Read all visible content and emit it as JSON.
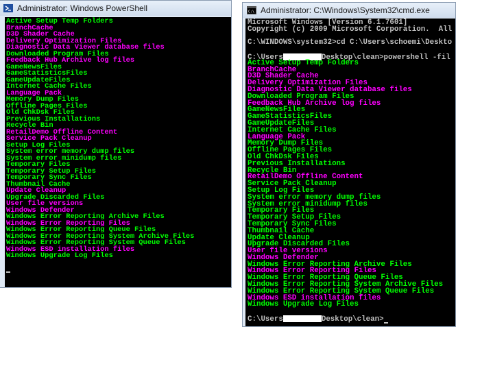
{
  "powershell_window": {
    "title": "Administrator: Windows PowerShell",
    "icon": "powershell-icon",
    "lines": [
      {
        "text": "Active Setup Temp Folders",
        "color": "green"
      },
      {
        "text": "BranchCache",
        "color": "magenta"
      },
      {
        "text": "D3D Shader Cache",
        "color": "magenta"
      },
      {
        "text": "Delivery Optimization Files",
        "color": "magenta"
      },
      {
        "text": "Diagnostic Data Viewer database files",
        "color": "magenta"
      },
      {
        "text": "Downloaded Program Files",
        "color": "green"
      },
      {
        "text": "Feedback Hub Archive log files",
        "color": "magenta"
      },
      {
        "text": "GameNewsFiles",
        "color": "green"
      },
      {
        "text": "GameStatisticsFiles",
        "color": "green"
      },
      {
        "text": "GameUpdateFiles",
        "color": "green"
      },
      {
        "text": "Internet Cache Files",
        "color": "green"
      },
      {
        "text": "Language Pack",
        "color": "magenta"
      },
      {
        "text": "Memory Dump Files",
        "color": "green"
      },
      {
        "text": "Offline Pages Files",
        "color": "green"
      },
      {
        "text": "Old ChkDsk Files",
        "color": "green"
      },
      {
        "text": "Previous Installations",
        "color": "green"
      },
      {
        "text": "Recycle Bin",
        "color": "green"
      },
      {
        "text": "RetailDemo Offline Content",
        "color": "magenta"
      },
      {
        "text": "Service Pack Cleanup",
        "color": "magenta"
      },
      {
        "text": "Setup Log Files",
        "color": "green"
      },
      {
        "text": "System error memory dump files",
        "color": "green"
      },
      {
        "text": "System error minidump files",
        "color": "green"
      },
      {
        "text": "Temporary Files",
        "color": "green"
      },
      {
        "text": "Temporary Setup Files",
        "color": "green"
      },
      {
        "text": "Temporary Sync Files",
        "color": "green"
      },
      {
        "text": "Thumbnail Cache",
        "color": "green"
      },
      {
        "text": "Update Cleanup",
        "color": "magenta"
      },
      {
        "text": "Upgrade Discarded Files",
        "color": "green"
      },
      {
        "text": "User file versions",
        "color": "magenta"
      },
      {
        "text": "Windows Defender",
        "color": "magenta"
      },
      {
        "text": "Windows Error Reporting Archive Files",
        "color": "green"
      },
      {
        "text": "Windows Error Reporting Files",
        "color": "magenta"
      },
      {
        "text": "Windows Error Reporting Queue Files",
        "color": "green"
      },
      {
        "text": "Windows Error Reporting System Archive Files",
        "color": "green"
      },
      {
        "text": "Windows Error Reporting System Queue Files",
        "color": "green"
      },
      {
        "text": "Windows ESD installation files",
        "color": "magenta"
      },
      {
        "text": "Windows Upgrade Log Files",
        "color": "green"
      }
    ]
  },
  "cmd_window": {
    "title": "Administrator: C:\\Windows\\System32\\cmd.exe",
    "icon": "cmd-icon",
    "header_lines": [
      "Microsoft Windows [Version 6.1.7601]",
      "Copyright (c) 2009 Microsoft Corporation.  All",
      "",
      "C:\\WINDOWS\\system32>cd C:\\Users\\schoemi\\Deskto",
      ""
    ],
    "prompt_prefix": "C:\\Users",
    "command_suffix": "Desktop\\clean>powershell -fil",
    "lines": [
      {
        "text": "Active Setup Temp Folders",
        "color": "green"
      },
      {
        "text": "BranchCache",
        "color": "magenta"
      },
      {
        "text": "D3D Shader Cache",
        "color": "magenta"
      },
      {
        "text": "Delivery Optimization Files",
        "color": "magenta"
      },
      {
        "text": "Diagnostic Data Viewer database files",
        "color": "magenta"
      },
      {
        "text": "Downloaded Program Files",
        "color": "green"
      },
      {
        "text": "Feedback Hub Archive log files",
        "color": "magenta"
      },
      {
        "text": "GameNewsFiles",
        "color": "green"
      },
      {
        "text": "GameStatisticsFiles",
        "color": "green"
      },
      {
        "text": "GameUpdateFiles",
        "color": "green"
      },
      {
        "text": "Internet Cache Files",
        "color": "green"
      },
      {
        "text": "Language Pack",
        "color": "magenta"
      },
      {
        "text": "Memory Dump Files",
        "color": "green"
      },
      {
        "text": "Offline Pages Files",
        "color": "green"
      },
      {
        "text": "Old ChkDsk Files",
        "color": "green"
      },
      {
        "text": "Previous Installations",
        "color": "green"
      },
      {
        "text": "Recycle Bin",
        "color": "green"
      },
      {
        "text": "RetailDemo Offline Content",
        "color": "magenta"
      },
      {
        "text": "Service Pack Cleanup",
        "color": "green"
      },
      {
        "text": "Setup Log Files",
        "color": "green"
      },
      {
        "text": "System error memory dump files",
        "color": "green"
      },
      {
        "text": "System error minidump files",
        "color": "green"
      },
      {
        "text": "Temporary Files",
        "color": "green"
      },
      {
        "text": "Temporary Setup Files",
        "color": "green"
      },
      {
        "text": "Temporary Sync Files",
        "color": "green"
      },
      {
        "text": "Thumbnail Cache",
        "color": "green"
      },
      {
        "text": "Update Cleanup",
        "color": "green"
      },
      {
        "text": "Upgrade Discarded Files",
        "color": "green"
      },
      {
        "text": "User file versions",
        "color": "magenta"
      },
      {
        "text": "Windows Defender",
        "color": "magenta"
      },
      {
        "text": "Windows Error Reporting Archive Files",
        "color": "green"
      },
      {
        "text": "Windows Error Reporting Files",
        "color": "magenta"
      },
      {
        "text": "Windows Error Reporting Queue Files",
        "color": "green"
      },
      {
        "text": "Windows Error Reporting System Archive Files",
        "color": "green"
      },
      {
        "text": "Windows Error Reporting System Queue Files",
        "color": "green"
      },
      {
        "text": "Windows ESD installation files",
        "color": "magenta"
      },
      {
        "text": "Windows Upgrade Log Files",
        "color": "green"
      }
    ],
    "final_prompt_suffix": "Desktop\\clean>"
  },
  "colors": {
    "green": "#00ff00",
    "magenta": "#ff00ff",
    "default": "#c0c0c0",
    "background": "#000000"
  }
}
